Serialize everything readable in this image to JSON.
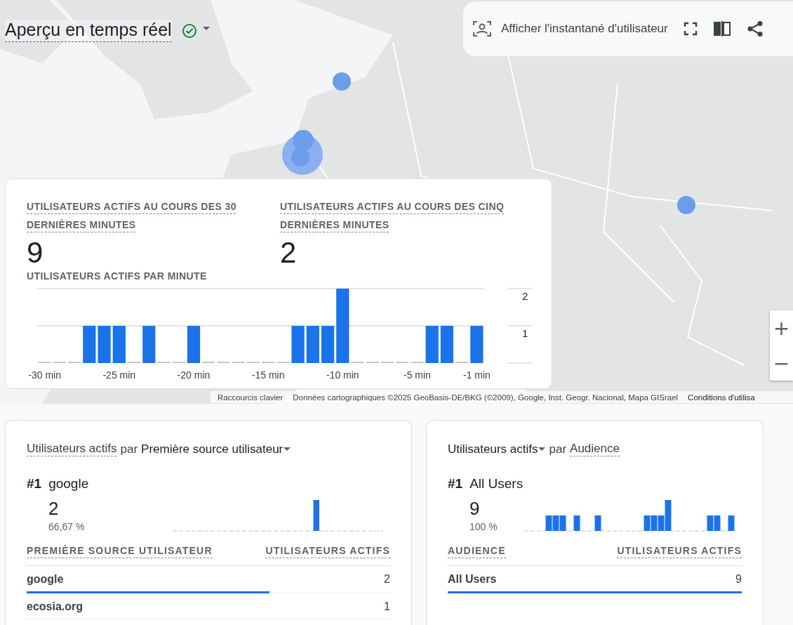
{
  "header": {
    "title": "Aperçu en temps réel"
  },
  "toolbar": {
    "snapshot_button": "Afficher l'instantané d'utilisateur"
  },
  "map": {
    "kind": "picture",
    "zoom_in": "+",
    "zoom_out": "−",
    "shortcuts": "Raccourcis clavier",
    "attribution": "Données cartographiques ©2025 GeoBasis-DE/BKG (©2009), Google, Inst. Geogr. Nacional, Mapa GISrael",
    "terms": "Conditions d'utilisa"
  },
  "summary": {
    "metrics": [
      {
        "label": "UTILISATEURS ACTIFS AU COURS DES 30 DERNIÈRES MINUTES",
        "value": "9"
      },
      {
        "label": "UTILISATEURS ACTIFS AU COURS DES CINQ DERNIÈRES MINUTES",
        "value": "2"
      }
    ],
    "chart_title": "UTILISATEURS ACTIFS PAR MINUTE",
    "chart_data": {
      "type": "bar",
      "x": [
        -30,
        -29,
        -28,
        -27,
        -26,
        -25,
        -24,
        -23,
        -22,
        -21,
        -20,
        -19,
        -18,
        -17,
        -16,
        -15,
        -14,
        -13,
        -12,
        -11,
        -10,
        -9,
        -8,
        -7,
        -6,
        -5,
        -4,
        -3,
        -2,
        -1
      ],
      "series": [
        {
          "color": "#1a73e8",
          "values": [
            0,
            0,
            0,
            1,
            1,
            1,
            0,
            1,
            0,
            0,
            1,
            0,
            0,
            0,
            0,
            0,
            0,
            1,
            1,
            1,
            2,
            0,
            0,
            0,
            0,
            0,
            1,
            1,
            0,
            1
          ]
        }
      ],
      "xticks": [
        {
          "value": -30,
          "label": "-30 min"
        },
        {
          "value": -25,
          "label": "-25 min"
        },
        {
          "value": -20,
          "label": "-20 min"
        },
        {
          "value": -15,
          "label": "-15 min"
        },
        {
          "value": -10,
          "label": "-10 min"
        },
        {
          "value": -5,
          "label": "-5 min"
        },
        {
          "value": -1,
          "label": "-1 min"
        }
      ],
      "xlim": [
        -30.5,
        -0.5
      ],
      "yticks": [
        1,
        2
      ],
      "ylim": [
        0,
        2
      ]
    }
  },
  "cards": [
    {
      "metric": {
        "label": "Utilisateurs actifs",
        "dropdown": false
      },
      "by": "par",
      "dimension": {
        "label": "Première source utilisateur",
        "dropdown": true
      },
      "rank": "#1",
      "top_name": "google",
      "top_value": "2",
      "top_share": "66,67 %",
      "columns": [
        "PREMIÈRE SOURCE UTILISATEUR",
        "UTILISATEURS ACTIFS"
      ],
      "rows": [
        {
          "name": "google",
          "value": "2",
          "level": 0.667
        },
        {
          "name": "ecosia.org",
          "value": "1"
        }
      ]
    },
    {
      "metric": {
        "label": "Utilisateurs actifs",
        "dropdown": true
      },
      "by": "par",
      "dimension": {
        "label": "Audience",
        "dropdown": false
      },
      "rank": "#1",
      "top_name": "All Users",
      "top_value": "9",
      "top_share": "100 %",
      "columns": [
        "AUDIENCE",
        "UTILISATEURS ACTIFS"
      ],
      "rows": [
        {
          "name": "All Users",
          "value": "9",
          "level": 1
        }
      ]
    }
  ]
}
